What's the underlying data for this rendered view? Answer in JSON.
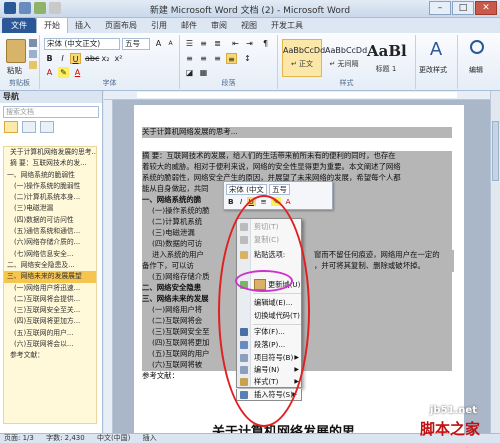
{
  "window": {
    "title": "新建 Microsoft Word 文档 (2) - Microsoft Word",
    "minimize": "–",
    "maximize": "□",
    "close": "✕"
  },
  "tabs": [
    "文件",
    "开始",
    "插入",
    "页面布局",
    "引用",
    "邮件",
    "审阅",
    "视图",
    "开发工具"
  ],
  "ribbon": {
    "clipboard_group": "剪贴板",
    "paste_label": "粘贴",
    "font_name": "宋体 (中文正文)",
    "font_size": "五号",
    "font_group": "字体",
    "paragraph_group": "段落",
    "styles_group": "样式",
    "styles": [
      {
        "sample": "AaBbCcDd",
        "name": "↵ 正文"
      },
      {
        "sample": "AaBbCcDd",
        "name": "↵ 无间隔"
      },
      {
        "sample": "AaBl",
        "name": "标题 1"
      }
    ],
    "change_styles": "更改样式",
    "editing": "编辑"
  },
  "nav": {
    "title": "导航",
    "search_placeholder": "搜索文档",
    "items": [
      "关于计算机网络发展的思考...",
      "摘 要：互联网技术的发...",
      "一、网络系统的脆弱性",
      "(一)操作系统的脆弱性",
      "(二)计算机系统本身...",
      "(三)电磁泄漏",
      "(四)数据的可访问性",
      "(五)通信系统和通信...",
      "(六)网络存储介质的...",
      "(七)网络信息安全...",
      "二、网络安全隐患及...",
      "三、网络未来的发展展望",
      "(一)网络用户将迅速...",
      "(二)互联网将会提供...",
      "(三)互联网安全至关...",
      "(四)互联网将更加方...",
      "(五)互联网的用户...",
      "(六)互联网将会以...",
      "参考文献："
    ]
  },
  "document": {
    "lines": [
      "关于计算机网络发展的思考...",
      "",
      "摘 要：互联网技术的发展，给人们的生活带来前所未有的便利的同时，也存在",
      "着较大的威胁。相对于便利来说，网络的安全性显得更为重要。本文阐述了网络",
      "系统的脆弱性，网络安全产生的原因，并展望了未来网络的发展，希望每个人都",
      "能从自身做起，共同",
      "一、网络系统的脆",
      "(一)操作系统的脆",
      "(二)计算机系统",
      "(三)电磁泄漏",
      "(四)数据的可访",
      "进入系统的用户",
      "备作下，可以访",
      "(五)网络存储介质",
      "二、网络安全隐患",
      "三、网络未来的发展",
      "(一)网络用户将",
      "(二)互联网将会",
      "(三)互联网安全至",
      "(四)互联网将更加",
      "(五)互联网的用户",
      "(六)互联网将被",
      "参考文献："
    ],
    "right_fragments": [
      "窗而不留任何痕迹，网络用户在一定的",
      "，并可将其复制、删除或破坏掉。"
    ],
    "next_title": "关于计算机网络发展的思"
  },
  "mini_toolbar": {
    "font": "宋体 (中文",
    "size": "五号",
    "bold": "B",
    "italic": "I",
    "underline": "U"
  },
  "context_menu": [
    {
      "label": "剪切(T)",
      "enabled": false
    },
    {
      "label": "复制(C)",
      "enabled": false
    },
    {
      "label": "粘贴选项:",
      "enabled": true
    },
    {
      "label": "更新域(U)",
      "enabled": true
    },
    {
      "label": "编辑域(E)...",
      "enabled": true
    },
    {
      "label": "切换域代码(T)",
      "enabled": true
    },
    {
      "label": "字体(F)...",
      "enabled": true
    },
    {
      "label": "段落(P)...",
      "enabled": true
    },
    {
      "label": "项目符号(B)",
      "enabled": true,
      "submenu": true
    },
    {
      "label": "编号(N)",
      "enabled": true,
      "submenu": true
    },
    {
      "label": "样式(T)",
      "enabled": true,
      "submenu": true
    },
    {
      "label": "插入符号(S)",
      "enabled": true,
      "submenu": true
    }
  ],
  "status": {
    "page": "页面: 1/3",
    "words": "字数: 2,430",
    "lang": "中文(中国)",
    "mode": "插入"
  },
  "watermark": {
    "site": "jb51.net",
    "name": "脚本之家"
  },
  "colors": {
    "accent": "#2b5797",
    "highlight": "#b6b6b6",
    "ring_red": "#e02020",
    "ring_pink": "#cc33cc"
  }
}
